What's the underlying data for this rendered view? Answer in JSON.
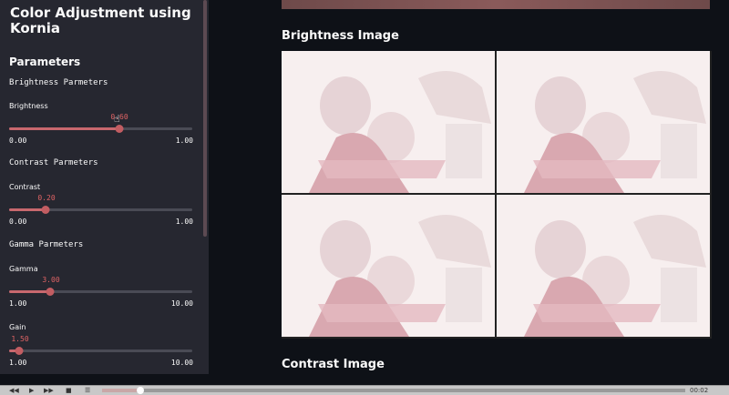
{
  "sidebar": {
    "title": "Color Adjustment using Kornia",
    "parameters_heading": "Parameters",
    "brightness_section": "Brightness Parmeters",
    "brightness": {
      "label": "Brightness",
      "value": "0.60",
      "min": "0.00",
      "max": "1.00",
      "fraction": 0.6
    },
    "contrast_section": "Contrast Parmeters",
    "contrast": {
      "label": "Contrast",
      "value": "0.20",
      "min": "0.00",
      "max": "1.00",
      "fraction": 0.2
    },
    "gamma_section": "Gamma Parmeters",
    "gamma": {
      "label": "Gamma",
      "value": "3.00",
      "min": "1.00",
      "max": "10.00",
      "fraction": 0.222
    },
    "gain": {
      "label": "Gain",
      "value": "1.50",
      "min": "1.00",
      "max": "10.00",
      "fraction": 0.056
    }
  },
  "main": {
    "brightness_image_title": "Brightness Image",
    "contrast_image_title": "Contrast Image"
  },
  "player": {
    "time": "00:02",
    "progress": 0.06
  },
  "colors": {
    "accent": "#c25d62",
    "sidebar_bg": "#262730",
    "main_bg": "#0e1117"
  }
}
